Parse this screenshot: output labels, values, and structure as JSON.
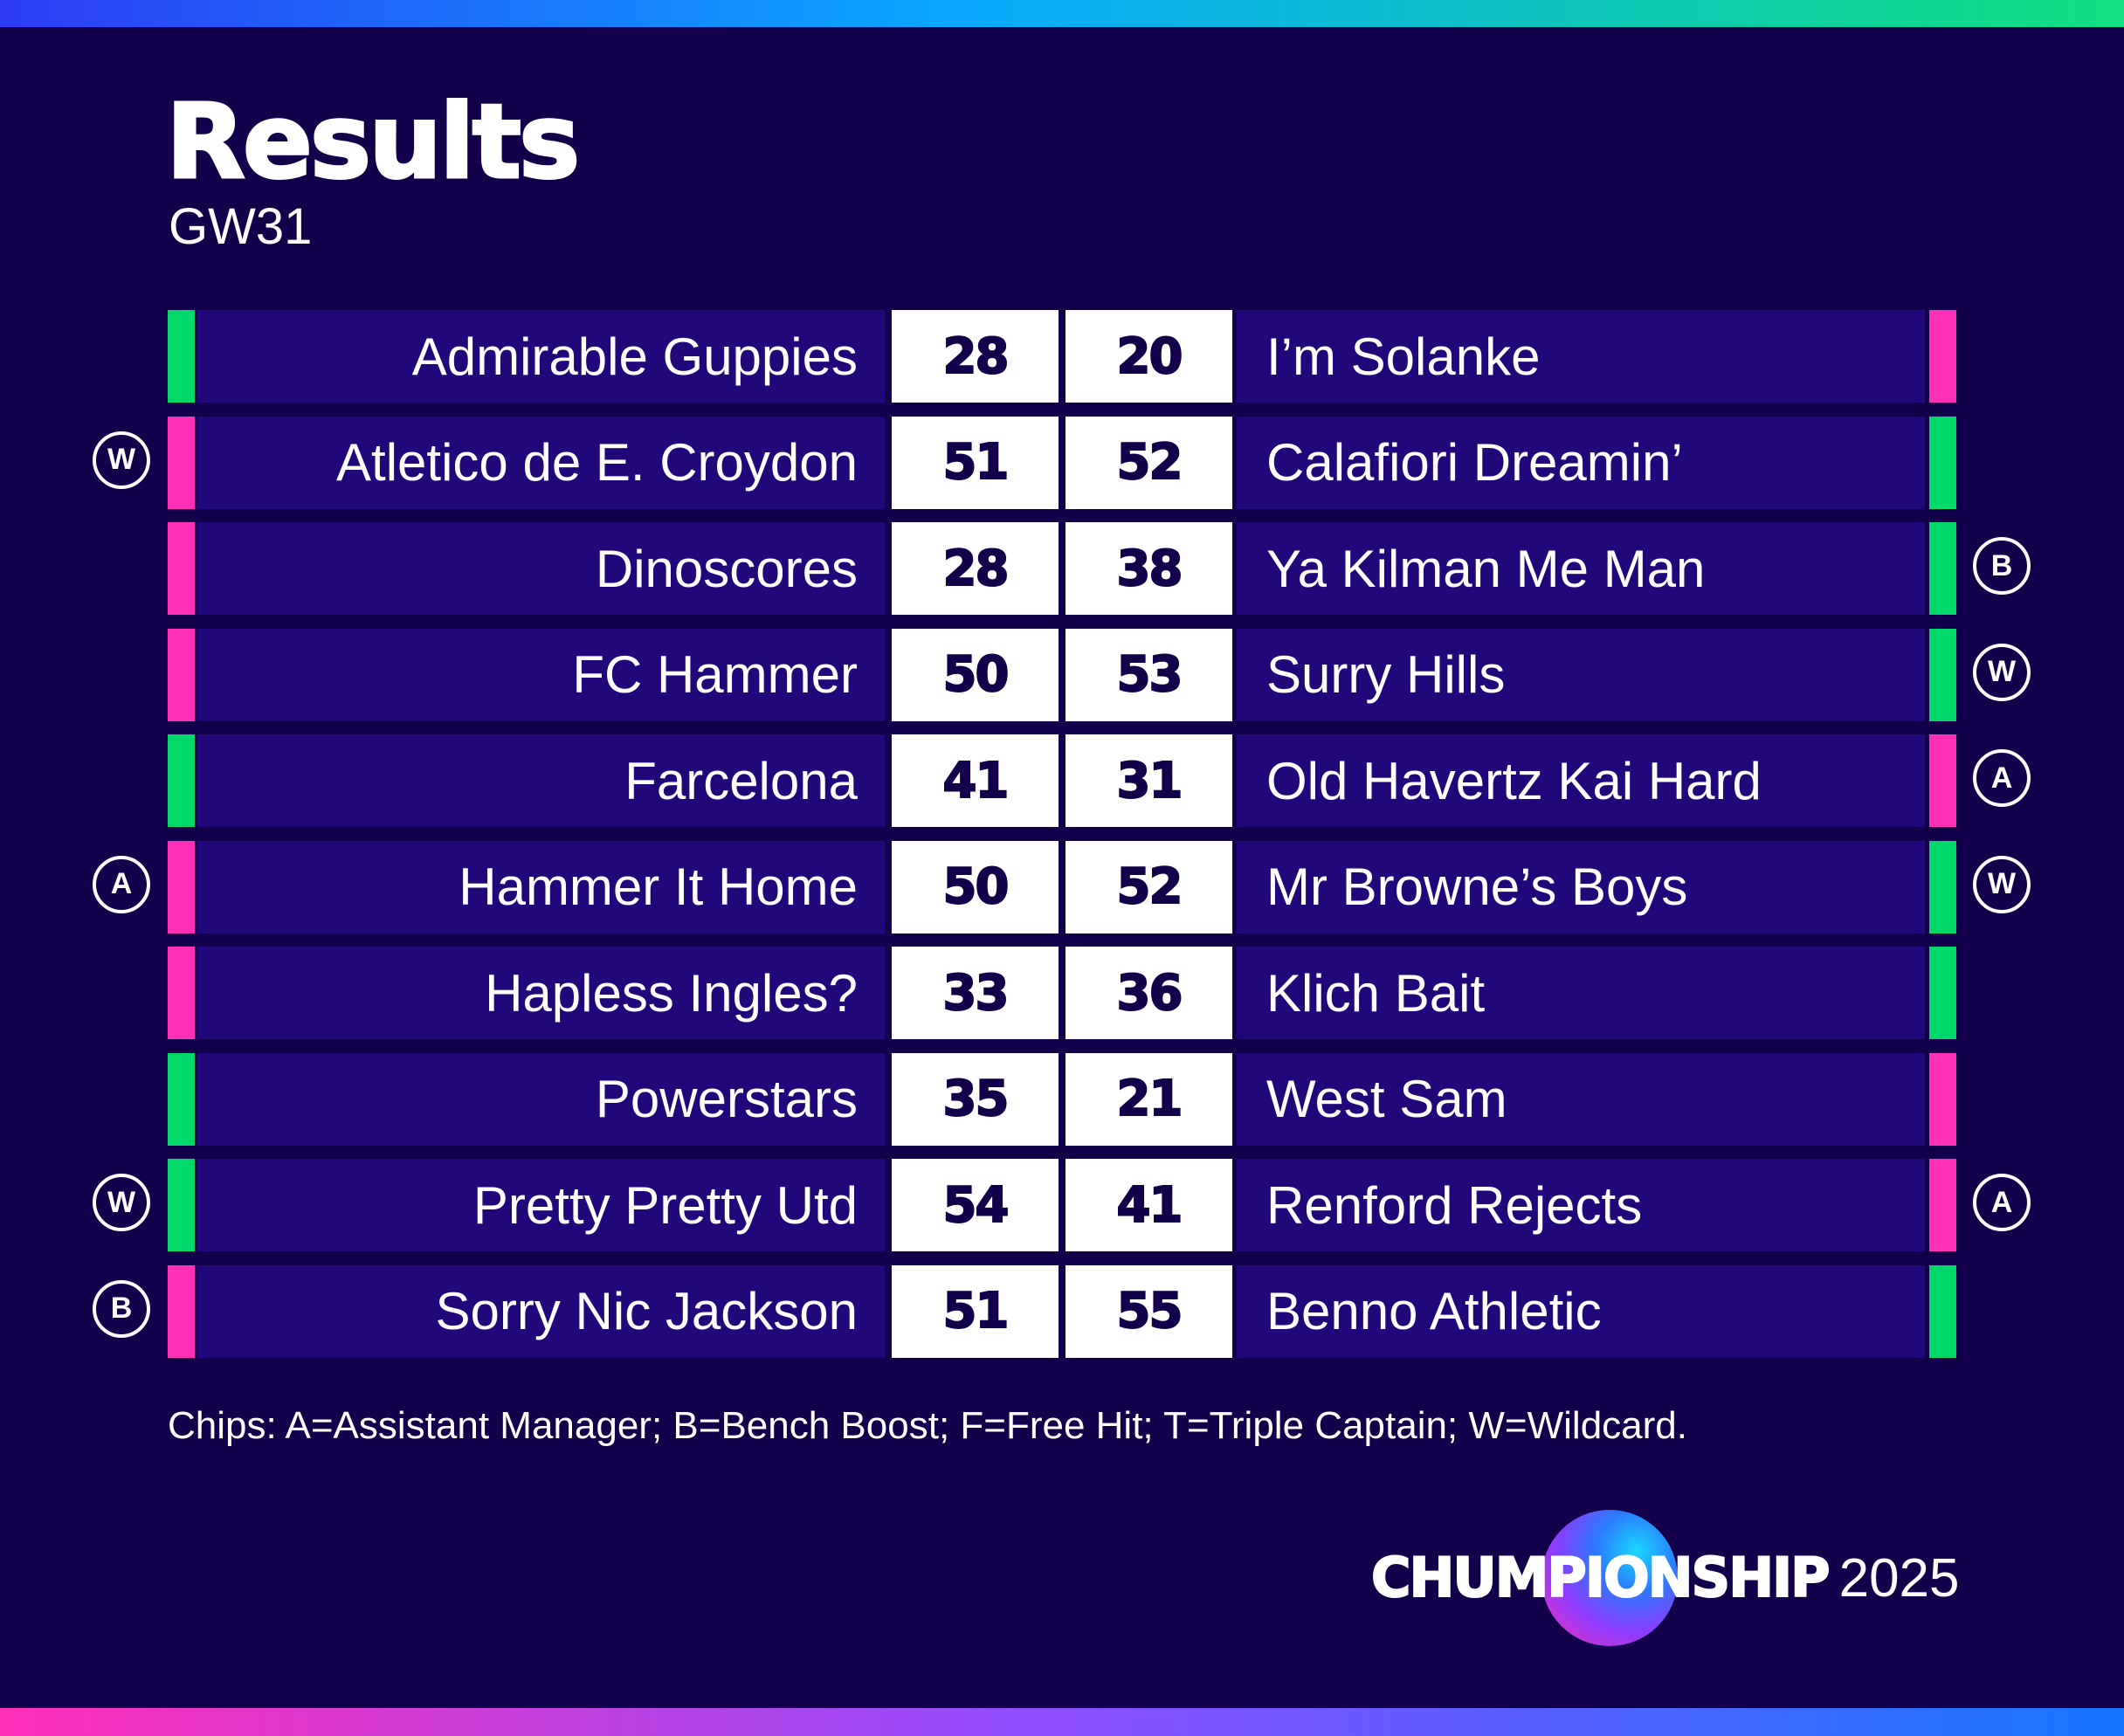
{
  "header": {
    "title": "Results",
    "subtitle": "GW31"
  },
  "colors": {
    "background": "#12004a",
    "team_cell": "#21077a",
    "win": "#00d96a",
    "loss": "#ff2fb7",
    "score_cell": "#ffffff"
  },
  "fixtures": [
    {
      "home": {
        "name": "Admirable Guppies",
        "score": "28",
        "result": "win",
        "chip": ""
      },
      "away": {
        "name": "I’m Solanke",
        "score": "20",
        "result": "loss",
        "chip": ""
      }
    },
    {
      "home": {
        "name": "Atletico de E. Croydon",
        "score": "51",
        "result": "loss",
        "chip": "W"
      },
      "away": {
        "name": "Calafiori Dreamin’",
        "score": "52",
        "result": "win",
        "chip": ""
      }
    },
    {
      "home": {
        "name": "Dinoscores",
        "score": "28",
        "result": "loss",
        "chip": ""
      },
      "away": {
        "name": "Ya Kilman Me Man",
        "score": "38",
        "result": "win",
        "chip": "B"
      }
    },
    {
      "home": {
        "name": "FC Hammer",
        "score": "50",
        "result": "loss",
        "chip": ""
      },
      "away": {
        "name": "Surry Hills",
        "score": "53",
        "result": "win",
        "chip": "W"
      }
    },
    {
      "home": {
        "name": "Farcelona",
        "score": "41",
        "result": "win",
        "chip": ""
      },
      "away": {
        "name": "Old Havertz Kai Hard",
        "score": "31",
        "result": "loss",
        "chip": "A"
      }
    },
    {
      "home": {
        "name": "Hammer It Home",
        "score": "50",
        "result": "loss",
        "chip": "A"
      },
      "away": {
        "name": "Mr Browne’s Boys",
        "score": "52",
        "result": "win",
        "chip": "W"
      }
    },
    {
      "home": {
        "name": "Hapless Ingles?",
        "score": "33",
        "result": "loss",
        "chip": ""
      },
      "away": {
        "name": "Klich Bait",
        "score": "36",
        "result": "win",
        "chip": ""
      }
    },
    {
      "home": {
        "name": "Powerstars",
        "score": "35",
        "result": "win",
        "chip": ""
      },
      "away": {
        "name": "West Sam",
        "score": "21",
        "result": "loss",
        "chip": ""
      }
    },
    {
      "home": {
        "name": "Pretty Pretty Utd",
        "score": "54",
        "result": "win",
        "chip": "W"
      },
      "away": {
        "name": "Renford Rejects",
        "score": "41",
        "result": "loss",
        "chip": "A"
      }
    },
    {
      "home": {
        "name": "Sorry Nic Jackson",
        "score": "51",
        "result": "loss",
        "chip": "B"
      },
      "away": {
        "name": "Benno Athletic",
        "score": "55",
        "result": "win",
        "chip": ""
      }
    }
  ],
  "footnote": "Chips: A=Assistant Manager; B=Bench Boost; F=Free Hit; T=Triple Captain; W=Wildcard.",
  "brand": {
    "name": "CHUMPIONSHIP",
    "year": "2025"
  }
}
